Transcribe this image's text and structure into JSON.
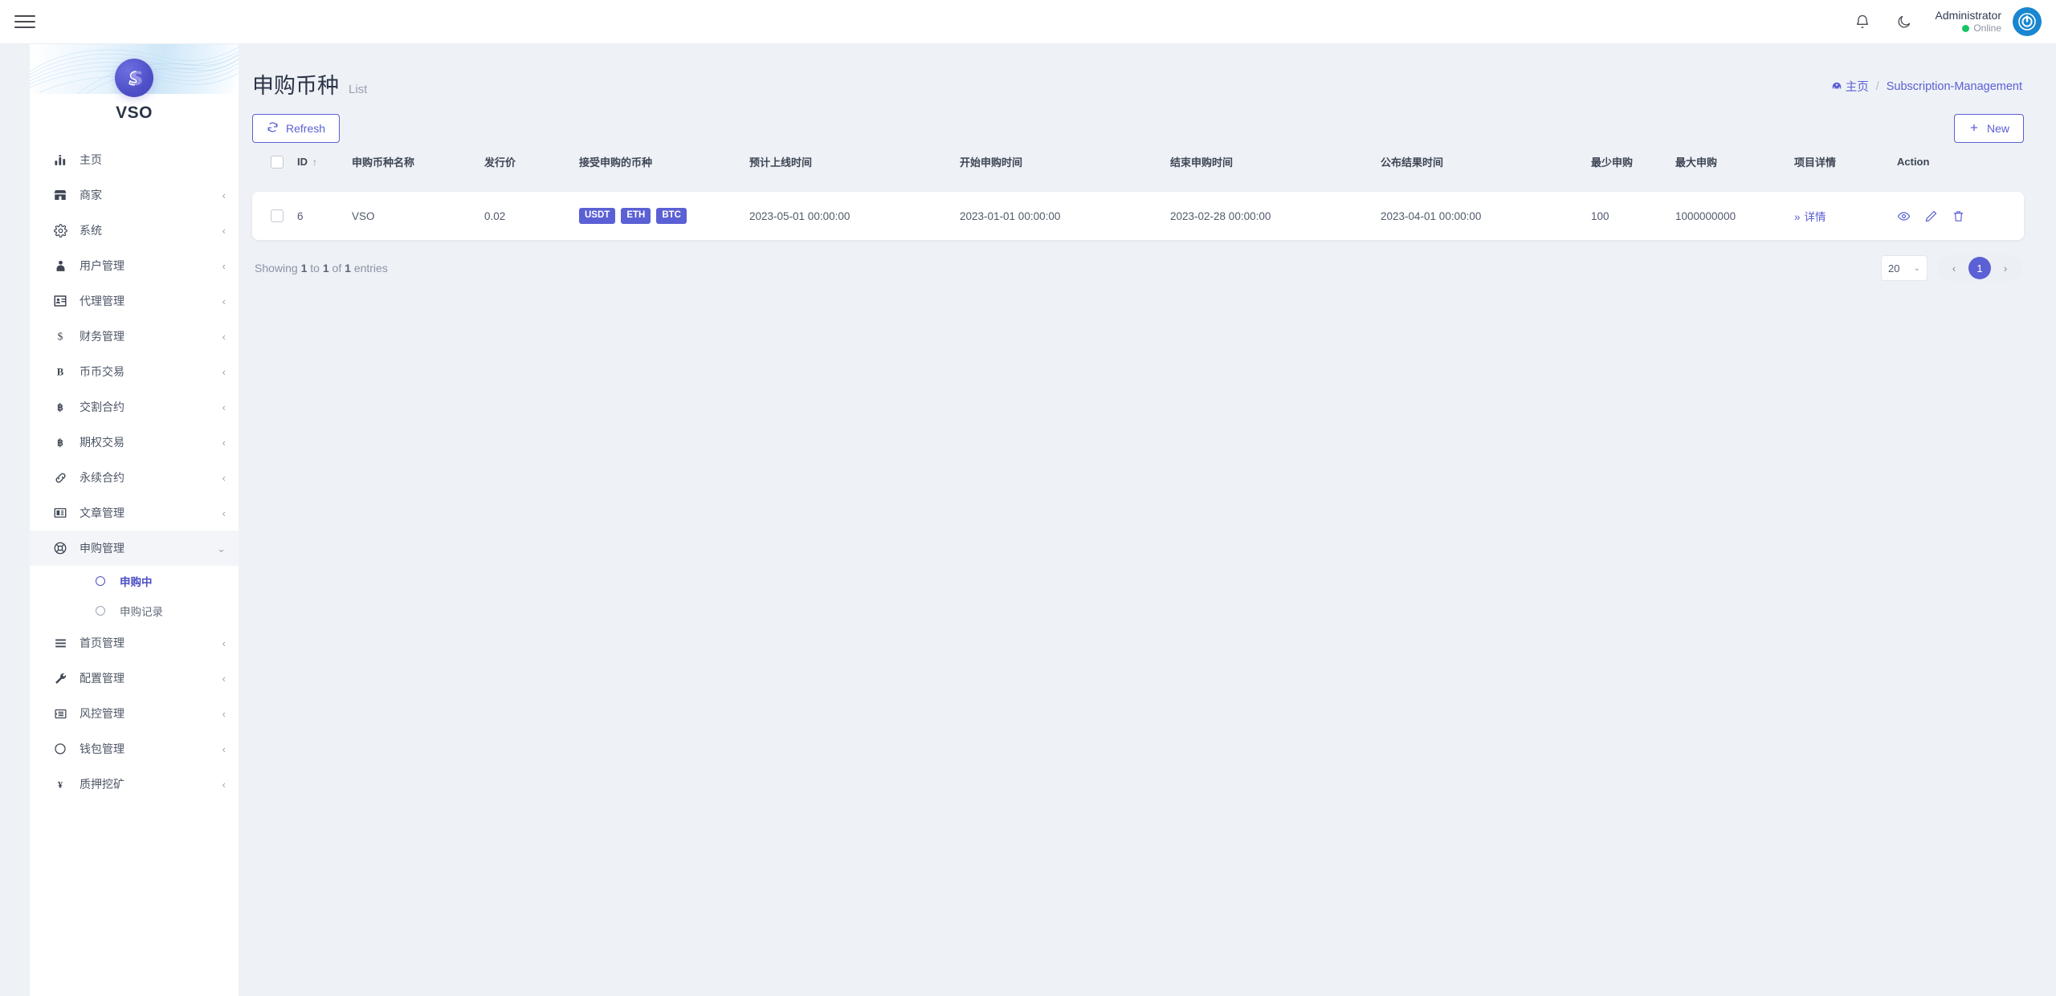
{
  "topbar": {
    "menu_toggle": "menu-toggle",
    "notification_icon": "bell-icon",
    "theme_icon": "moon-icon",
    "user_name": "Administrator",
    "user_status": "Online"
  },
  "sidebar": {
    "brand_name": "VSO",
    "items": [
      {
        "label": "主页",
        "icon": "chart-bar-icon",
        "has_children": false,
        "active": false
      },
      {
        "label": "商家",
        "icon": "store-icon",
        "has_children": true,
        "active": false
      },
      {
        "label": "系统",
        "icon": "gear-icon",
        "has_children": true,
        "active": false
      },
      {
        "label": "用户管理",
        "icon": "user-tie-icon",
        "has_children": true,
        "active": false
      },
      {
        "label": "代理管理",
        "icon": "id-card-icon",
        "has_children": true,
        "active": false
      },
      {
        "label": "财务管理",
        "icon": "dollar-icon",
        "has_children": true,
        "active": false
      },
      {
        "label": "币币交易",
        "icon": "letter-b-icon",
        "has_children": true,
        "active": false
      },
      {
        "label": "交割合约",
        "icon": "bitcoin-icon",
        "has_children": true,
        "active": false
      },
      {
        "label": "期权交易",
        "icon": "bitcoin-icon",
        "has_children": true,
        "active": false
      },
      {
        "label": "永续合约",
        "icon": "link-icon",
        "has_children": true,
        "active": false
      },
      {
        "label": "文章管理",
        "icon": "newspaper-icon",
        "has_children": true,
        "active": false
      },
      {
        "label": "申购管理",
        "icon": "lifebuoy-icon",
        "has_children": true,
        "active": true
      },
      {
        "label": "首页管理",
        "icon": "bars-icon",
        "has_children": true,
        "active": false
      },
      {
        "label": "配置管理",
        "icon": "wrench-icon",
        "has_children": true,
        "active": false
      },
      {
        "label": "风控管理",
        "icon": "list-icon",
        "has_children": true,
        "active": false
      },
      {
        "label": "钱包管理",
        "icon": "circle-icon",
        "has_children": true,
        "active": false
      },
      {
        "label": "质押挖矿",
        "icon": "yen-icon",
        "has_children": true,
        "active": false
      }
    ],
    "subitems": [
      {
        "label": "申购中",
        "active": true
      },
      {
        "label": "申购记录",
        "active": false
      }
    ]
  },
  "page": {
    "title": "申购币种",
    "subtitle": "List",
    "breadcrumb_home": "主页",
    "breadcrumb_sep": "/",
    "breadcrumb_current": "Subscription-Management"
  },
  "toolbar": {
    "refresh_label": "Refresh",
    "refresh_icon": "refresh-icon",
    "new_label": "New",
    "new_icon": "plus-icon"
  },
  "table": {
    "columns": [
      "ID",
      "申购币种名称",
      "发行价",
      "接受申购的币种",
      "预计上线时间",
      "开始申购时间",
      "结束申购时间",
      "公布结果时间",
      "最少申购",
      "最大申购",
      "项目详情",
      "Action"
    ],
    "sort_indicator": "↑",
    "rows": [
      {
        "id": "6",
        "name": "VSO",
        "issue_price": "0.02",
        "accepted_coins": [
          "USDT",
          "ETH",
          "BTC"
        ],
        "expected_online_time": "2023-05-01 00:00:00",
        "start_time": "2023-01-01 00:00:00",
        "end_time": "2023-02-28 00:00:00",
        "result_time": "2023-04-01 00:00:00",
        "min_subscription": "100",
        "max_subscription": "1000000000",
        "detail_label": "详情",
        "detail_chevron": "»",
        "actions": [
          "eye-icon",
          "pencil-icon",
          "trash-icon"
        ]
      }
    ]
  },
  "footer": {
    "entries_prefix": "Showing",
    "entries_from": "1",
    "entries_mid": "to",
    "entries_to": "1",
    "entries_of": "of",
    "entries_total": "1",
    "entries_suffix": "entries",
    "page_size": "20",
    "prev_label": "‹",
    "current_page": "1",
    "next_label": "›"
  },
  "colors": {
    "accent": "#5b60d4",
    "badge": "#5b60d4",
    "online": "#16c464",
    "page_bg": "#eef1f6"
  }
}
